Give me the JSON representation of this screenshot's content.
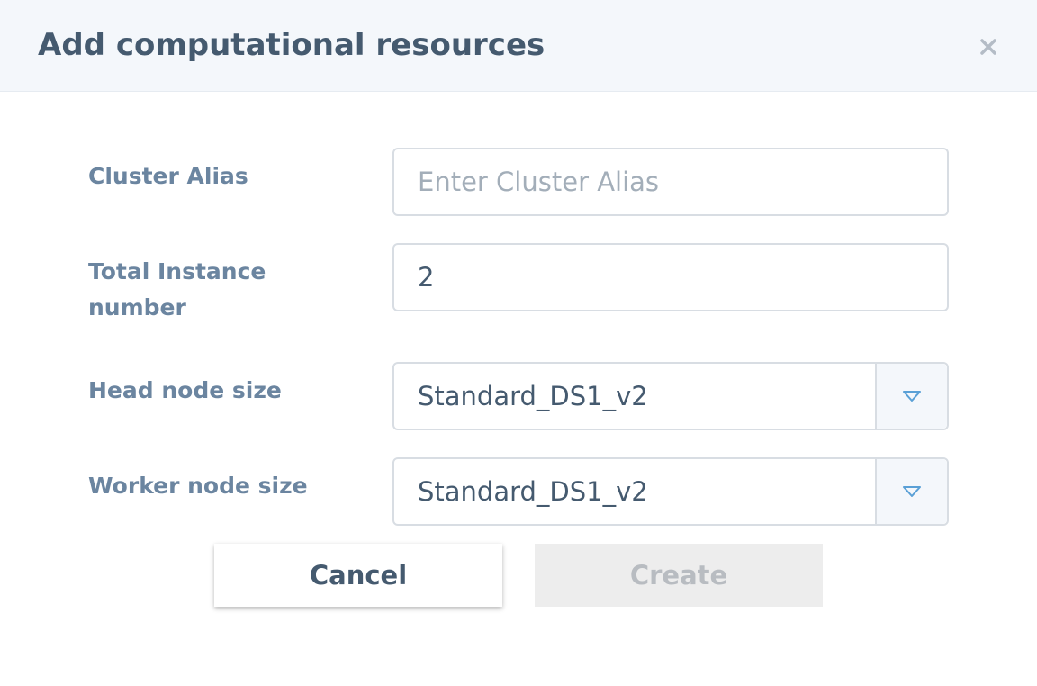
{
  "dialog": {
    "title": "Add computational resources",
    "close_icon": "close-icon"
  },
  "form": {
    "cluster_alias": {
      "label": "Cluster Alias",
      "value": "",
      "placeholder": "Enter Cluster Alias"
    },
    "total_instance": {
      "label": "Total Instance number",
      "value": "2"
    },
    "head_node": {
      "label": "Head node size",
      "selected": "Standard_DS1_v2",
      "icon": "chevron-down-icon"
    },
    "worker_node": {
      "label": "Worker node size",
      "selected": "Standard_DS1_v2",
      "icon": "chevron-down-icon"
    }
  },
  "actions": {
    "cancel_label": "Cancel",
    "create_label": "Create"
  },
  "colors": {
    "header_bg": "#f4f7fb",
    "title": "#455a6f",
    "label": "#6b85a0",
    "border": "#d8dde3",
    "arrow": "#5aa0d6",
    "disabled_bg": "#ededed",
    "disabled_text": "#b8bcc1"
  }
}
